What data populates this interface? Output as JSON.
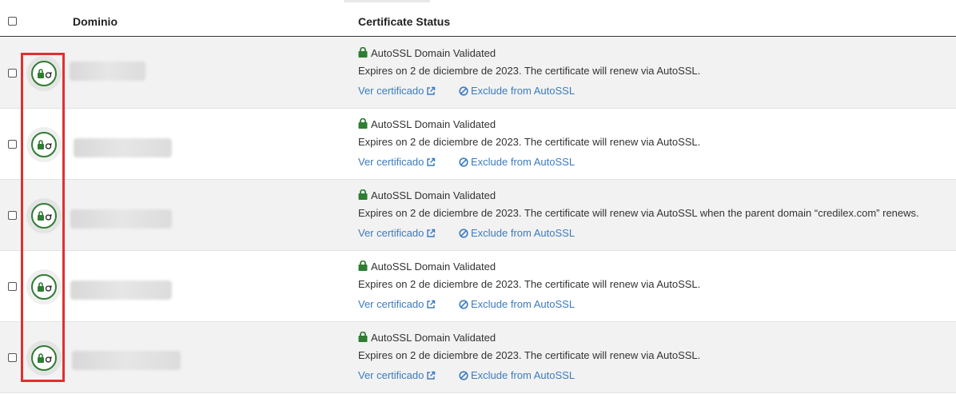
{
  "table": {
    "headers": {
      "domain": "Dominio",
      "status": "Certificate Status"
    },
    "rows": [
      {
        "status": "AutoSSL Domain Validated",
        "expires": "Expires on 2 de diciembre de 2023. The certificate will renew via AutoSSL.",
        "view_link": "Ver certificado",
        "exclude_link": "Exclude from AutoSSL"
      },
      {
        "status": "AutoSSL Domain Validated",
        "expires": "Expires on 2 de diciembre de 2023. The certificate will renew via AutoSSL.",
        "view_link": "Ver certificado",
        "exclude_link": "Exclude from AutoSSL"
      },
      {
        "status": "AutoSSL Domain Validated",
        "expires": "Expires on 2 de diciembre de 2023. The certificate will renew via AutoSSL when the parent domain “credilex.com” renews.",
        "view_link": "Ver certificado",
        "exclude_link": "Exclude from AutoSSL"
      },
      {
        "status": "AutoSSL Domain Validated",
        "expires": "Expires on 2 de diciembre de 2023. The certificate will renew via AutoSSL.",
        "view_link": "Ver certificado",
        "exclude_link": "Exclude from AutoSSL"
      },
      {
        "status": "AutoSSL Domain Validated",
        "expires": "Expires on 2 de diciembre de 2023. The certificate will renew via AutoSSL.",
        "view_link": "Ver certificado",
        "exclude_link": "Exclude from AutoSSL"
      }
    ]
  },
  "icons": {
    "status_icon": "lock-autorenew-icon",
    "status_lock": "lock-icon",
    "view_link_icon": "external-link-icon",
    "exclude_icon": "ban-icon"
  },
  "colors": {
    "valid_green": "#2e7d32",
    "link_blue": "#3b7bbf",
    "highlight_red": "#e03030"
  }
}
